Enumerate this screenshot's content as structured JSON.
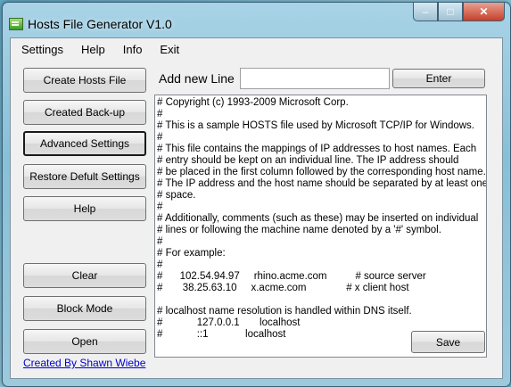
{
  "window": {
    "title": "Hosts File Generator V1.0"
  },
  "caption": {
    "minimize": "–",
    "maximize": "□",
    "close": "✕"
  },
  "menu": [
    "Settings",
    "Help",
    "Info",
    "Exit"
  ],
  "sidebar": {
    "buttons": [
      {
        "label": "Create Hosts File"
      },
      {
        "label": "Created Back-up"
      },
      {
        "label": "Advanced Settings"
      },
      {
        "label": "Restore Defult Settings"
      },
      {
        "label": "Help"
      },
      {
        "label": "Clear"
      },
      {
        "label": "Block Mode"
      },
      {
        "label": "Open"
      }
    ]
  },
  "add_line": {
    "label": "Add new Line",
    "value": "",
    "enter_label": "Enter"
  },
  "hosts_lines": [
    "# Copyright (c) 1993-2009 Microsoft Corp.",
    "#",
    "# This is a sample HOSTS file used by Microsoft TCP/IP for Windows.",
    "#",
    "# This file contains the mappings of IP addresses to host names. Each",
    "# entry should be kept on an individual line. The IP address should",
    "# be placed in the first column followed by the corresponding host name.",
    "# The IP address and the host name should be separated by at least one",
    "# space.",
    "#",
    "# Additionally, comments (such as these) may be inserted on individual",
    "# lines or following the machine name denoted by a '#' symbol.",
    "#",
    "# For example:",
    "#",
    "#      102.54.94.97     rhino.acme.com          # source server",
    "#       38.25.63.10     x.acme.com              # x client host",
    "",
    "# localhost name resolution is handled within DNS itself.",
    "#            127.0.0.1       localhost",
    "#            ::1             localhost"
  ],
  "save_label": "Save",
  "credit": "Created By Shawn Wiebe"
}
